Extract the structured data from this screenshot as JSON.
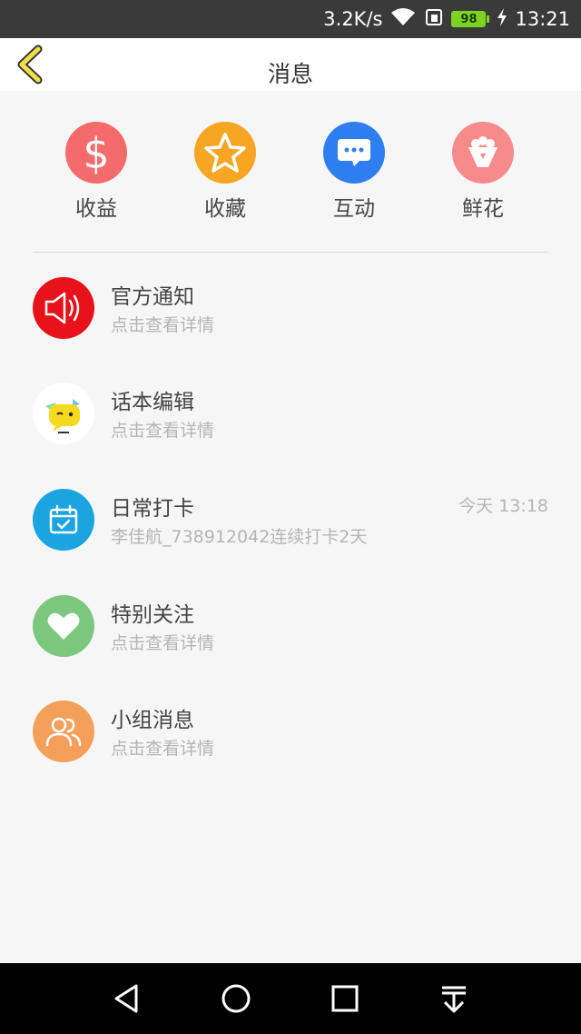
{
  "status_bar": {
    "speed": "3.2K/s",
    "battery": "98",
    "time": "13:21"
  },
  "header": {
    "title": "消息"
  },
  "quick_actions": [
    {
      "label": "收益",
      "icon": "dollar-icon",
      "color": "#f56b6b"
    },
    {
      "label": "收藏",
      "icon": "star-icon",
      "color": "#f6a623"
    },
    {
      "label": "互动",
      "icon": "chat-icon",
      "color": "#2f7ef0"
    },
    {
      "label": "鲜花",
      "icon": "bouquet-icon",
      "color": "#f78b8b"
    }
  ],
  "messages": [
    {
      "name": "官方通知",
      "sub": "点击查看详情",
      "time": "",
      "icon": "speaker-icon",
      "color": "#e8121a"
    },
    {
      "name": "话本编辑",
      "sub": "点击查看详情",
      "time": "",
      "icon": "editor-avatar",
      "color": "#ffffff"
    },
    {
      "name": "日常打卡",
      "sub": "李佳航_738912042连续打卡2天",
      "time": "今天 13:18",
      "icon": "calendar-icon",
      "color": "#1aa4e0"
    },
    {
      "name": "特别关注",
      "sub": "点击查看详情",
      "time": "",
      "icon": "heart-icon",
      "color": "#7cc77e"
    },
    {
      "name": "小组消息",
      "sub": "点击查看详情",
      "time": "",
      "icon": "group-icon",
      "color": "#f5a05a"
    }
  ]
}
